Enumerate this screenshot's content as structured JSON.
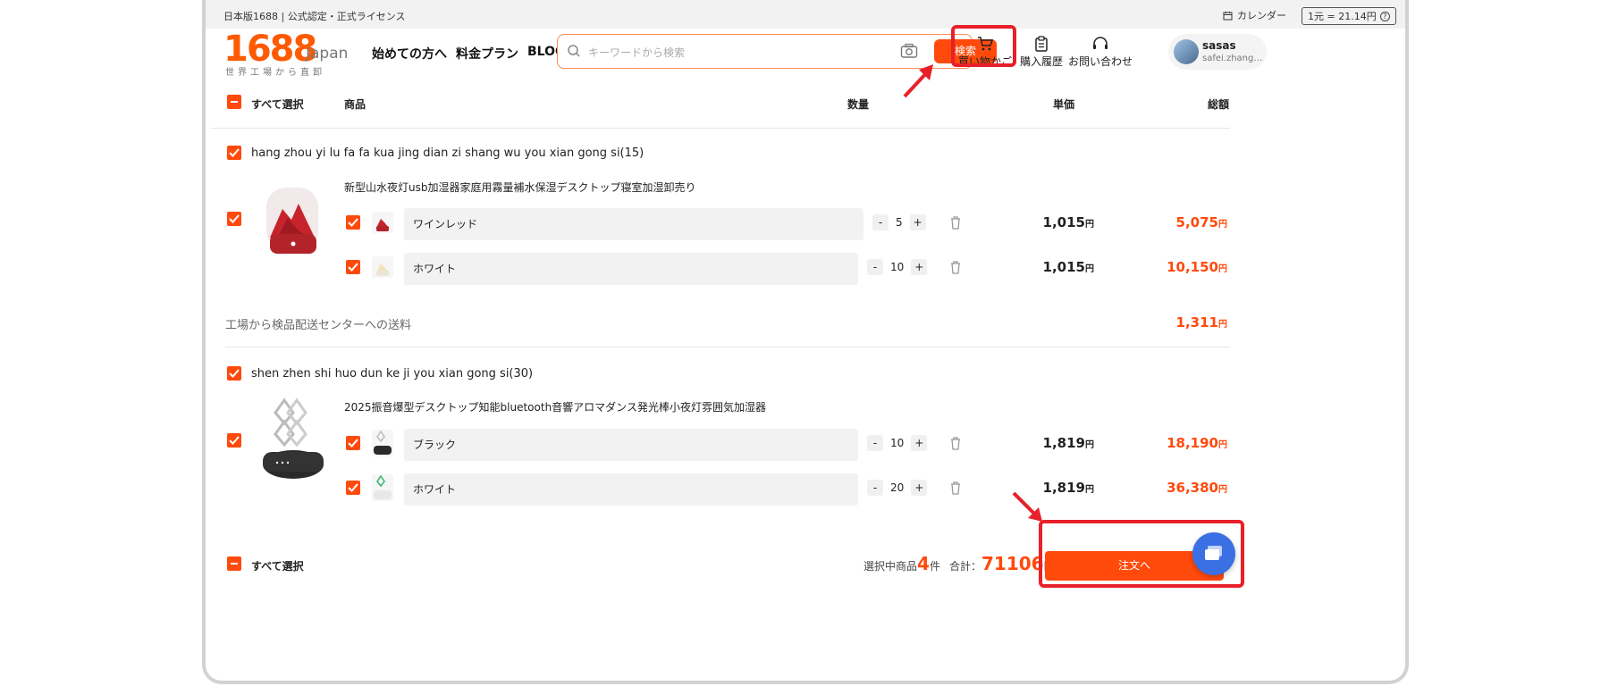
{
  "topbar": {
    "left_text": "日本版1688 | 公式認定・正式ライセンス",
    "calendar_label": "カレンダー",
    "rate_label": "1元 = 21.14円"
  },
  "logo": {
    "number": "1688",
    "suffix": "Japan",
    "tagline": "世界工場から直卸"
  },
  "nav": {
    "items": [
      "始めての方へ",
      "料金プラン",
      "BLOG"
    ]
  },
  "search": {
    "placeholder": "キーワードから検索",
    "button_label": "検索"
  },
  "header": {
    "cart_label": "買い物かご",
    "history_label": "購入履歴",
    "contact_label": "お問い合わせ",
    "user_name": "sasas",
    "user_email": "safei.zhang@..."
  },
  "table_header": {
    "select_all": "すべて選択",
    "product": "商品",
    "quantity": "数量",
    "unit_price": "単価",
    "total": "総額"
  },
  "shops": [
    {
      "name": "hang zhou yi lu fa fa kua jing dian zi shang wu you xian gong si(15)",
      "product_title": "新型山水夜灯usb加湿器家庭用霧量補水保湿デスクトップ寝室加湿卸売り",
      "variants": [
        {
          "name": "ワインレッド",
          "qty": "5",
          "unit": "1,015",
          "total": "5,075"
        },
        {
          "name": "ホワイト",
          "qty": "10",
          "unit": "1,015",
          "total": "10,150"
        }
      ],
      "shipping_label": "工場から検品配送センターへの送料",
      "shipping_value": "1,311"
    },
    {
      "name": "shen zhen shi huo dun ke ji you xian gong si(30)",
      "product_title": "2025振音爆型デスクトップ知能bluetooth音響アロマダンス発光棒小夜灯雰囲気加湿器",
      "variants": [
        {
          "name": "ブラック",
          "qty": "10",
          "unit": "1,819",
          "total": "18,190"
        },
        {
          "name": "ホワイト",
          "qty": "20",
          "unit": "1,819",
          "total": "36,380"
        }
      ]
    }
  ],
  "yen": "円",
  "footer": {
    "select_all": "すべて選択",
    "selected_prefix": "選択中商品",
    "selected_count": "4",
    "selected_suffix": "件",
    "total_prefix": "合計：",
    "total_value": "71106",
    "total_suffix": "円",
    "order_button": "注文へ"
  },
  "colors": {
    "accent": "#ff4a0c",
    "highlight_box": "#e8202a",
    "chat": "#3b6fe4"
  },
  "icons": [
    "search-icon",
    "camera-icon",
    "cart-icon",
    "clipboard-icon",
    "headset-icon",
    "calendar-icon",
    "help-icon",
    "trash-icon",
    "checkbox-icon",
    "chat-icon",
    "arrow-icon"
  ]
}
